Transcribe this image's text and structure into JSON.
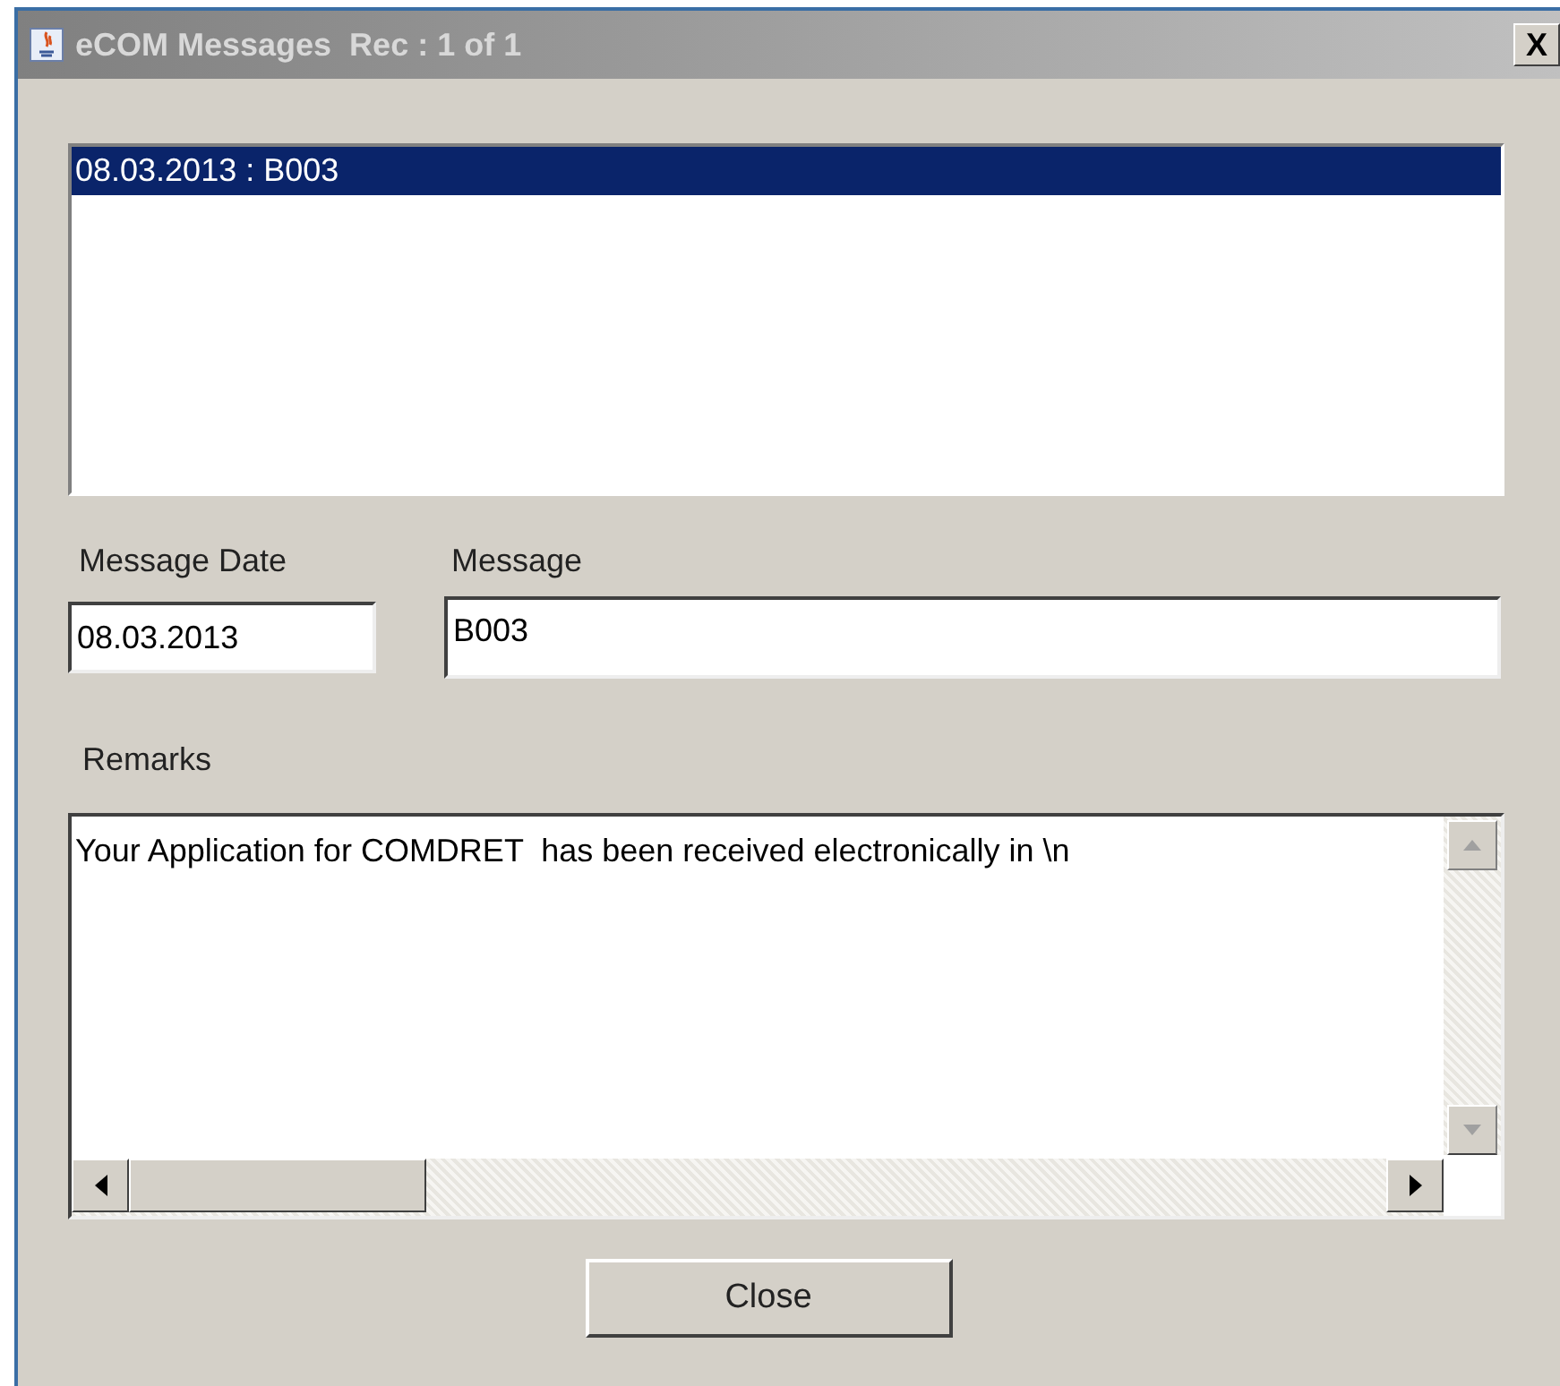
{
  "window": {
    "title": "eCOM Messages  Rec : 1 of 1",
    "close_label": "X"
  },
  "messages_list": {
    "items": [
      {
        "label": "08.03.2013 : B003",
        "selected": true
      }
    ]
  },
  "message_date": {
    "label": "Message Date",
    "value": "08.03.2013"
  },
  "message": {
    "label": "Message",
    "value": "B003"
  },
  "remarks": {
    "label": "Remarks",
    "value": "Your Application for COMDRET  has been received electronically in \\n"
  },
  "buttons": [
    "Close"
  ]
}
